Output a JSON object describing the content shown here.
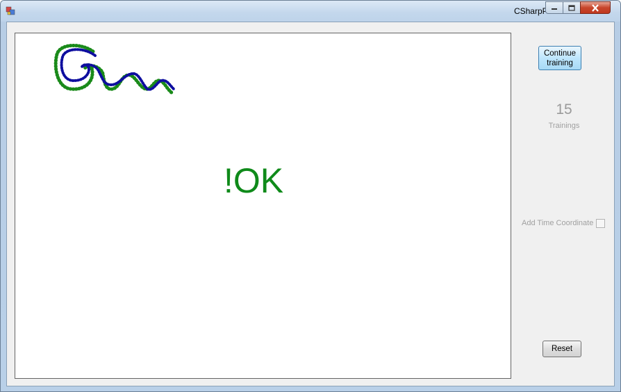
{
  "window": {
    "title": "CSharpPaint",
    "controls": [
      "minimize-icon",
      "maximize-icon",
      "close-icon"
    ]
  },
  "canvas": {
    "result_text": "!OK",
    "result_color": "#0f8a1a",
    "reference_stroke_color": "#1a8a1a",
    "drawn_stroke_color": "#1a1ad6"
  },
  "sidebar": {
    "continue_label": "Continue training",
    "trainings_count": "15",
    "trainings_label": "Trainings",
    "time_coordinate_label": "Add Time Coordinate",
    "time_coordinate_checked": false,
    "reset_label": "Reset"
  }
}
